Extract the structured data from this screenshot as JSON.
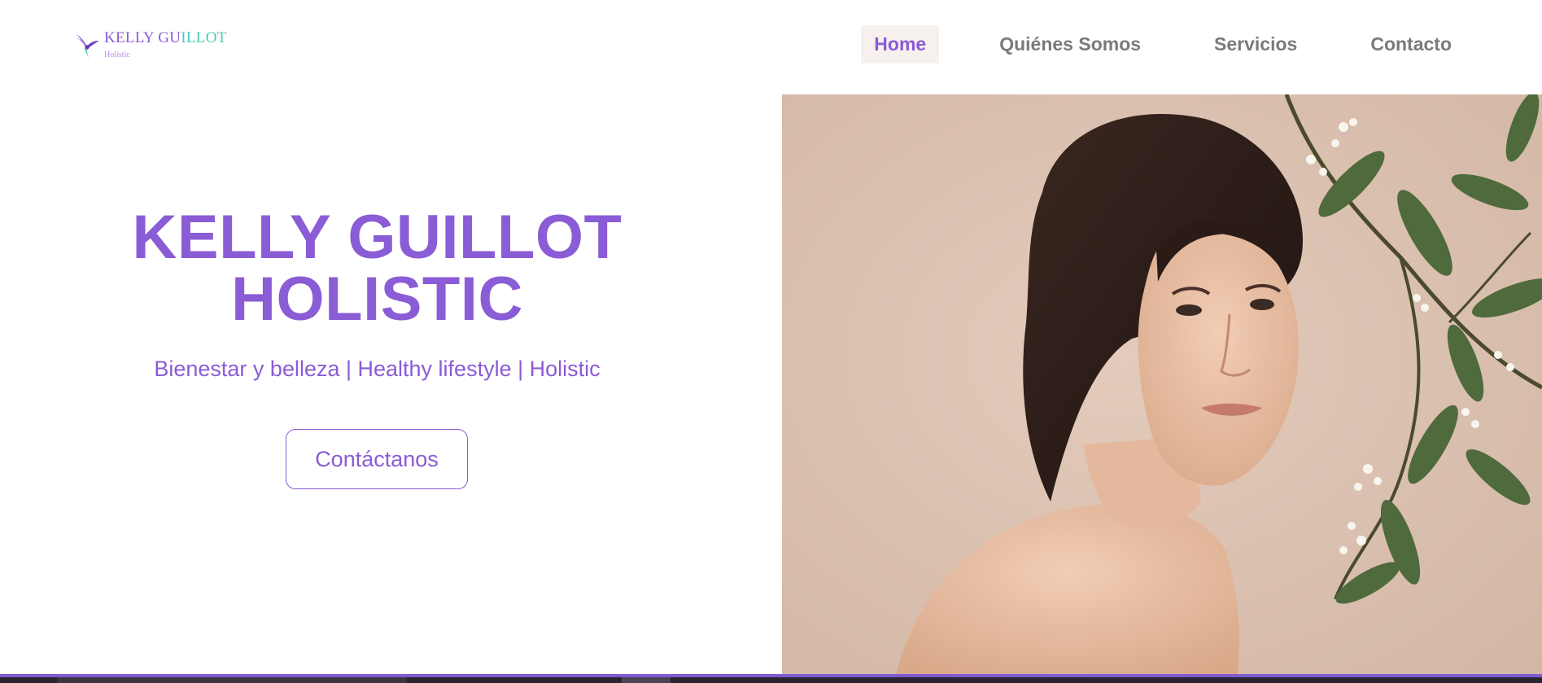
{
  "logo": {
    "name_part1": "KELLY GU",
    "name_part2": "ILLOT",
    "subtitle": "Holistic",
    "icon": "hummingbird-icon"
  },
  "nav": {
    "items": [
      {
        "label": "Home",
        "active": true
      },
      {
        "label": "Quiénes Somos",
        "active": false
      },
      {
        "label": "Servicios",
        "active": false
      },
      {
        "label": "Contacto",
        "active": false
      }
    ]
  },
  "hero": {
    "title_line1": "KELLY GUILLOT",
    "title_line2": "HOLISTIC",
    "tagline": "Bienestar y belleza | Healthy lifestyle | Holistic",
    "button_label": "Contáctanos",
    "image": "woman-with-flowering-branch-photo"
  },
  "colors": {
    "accent": "#8a5cd6",
    "logo_teal": "#4fc9b2",
    "nav_text": "#7a7a7a",
    "nav_active_bg": "#f6f1ee",
    "photo_bg": "#dcc3b3"
  }
}
